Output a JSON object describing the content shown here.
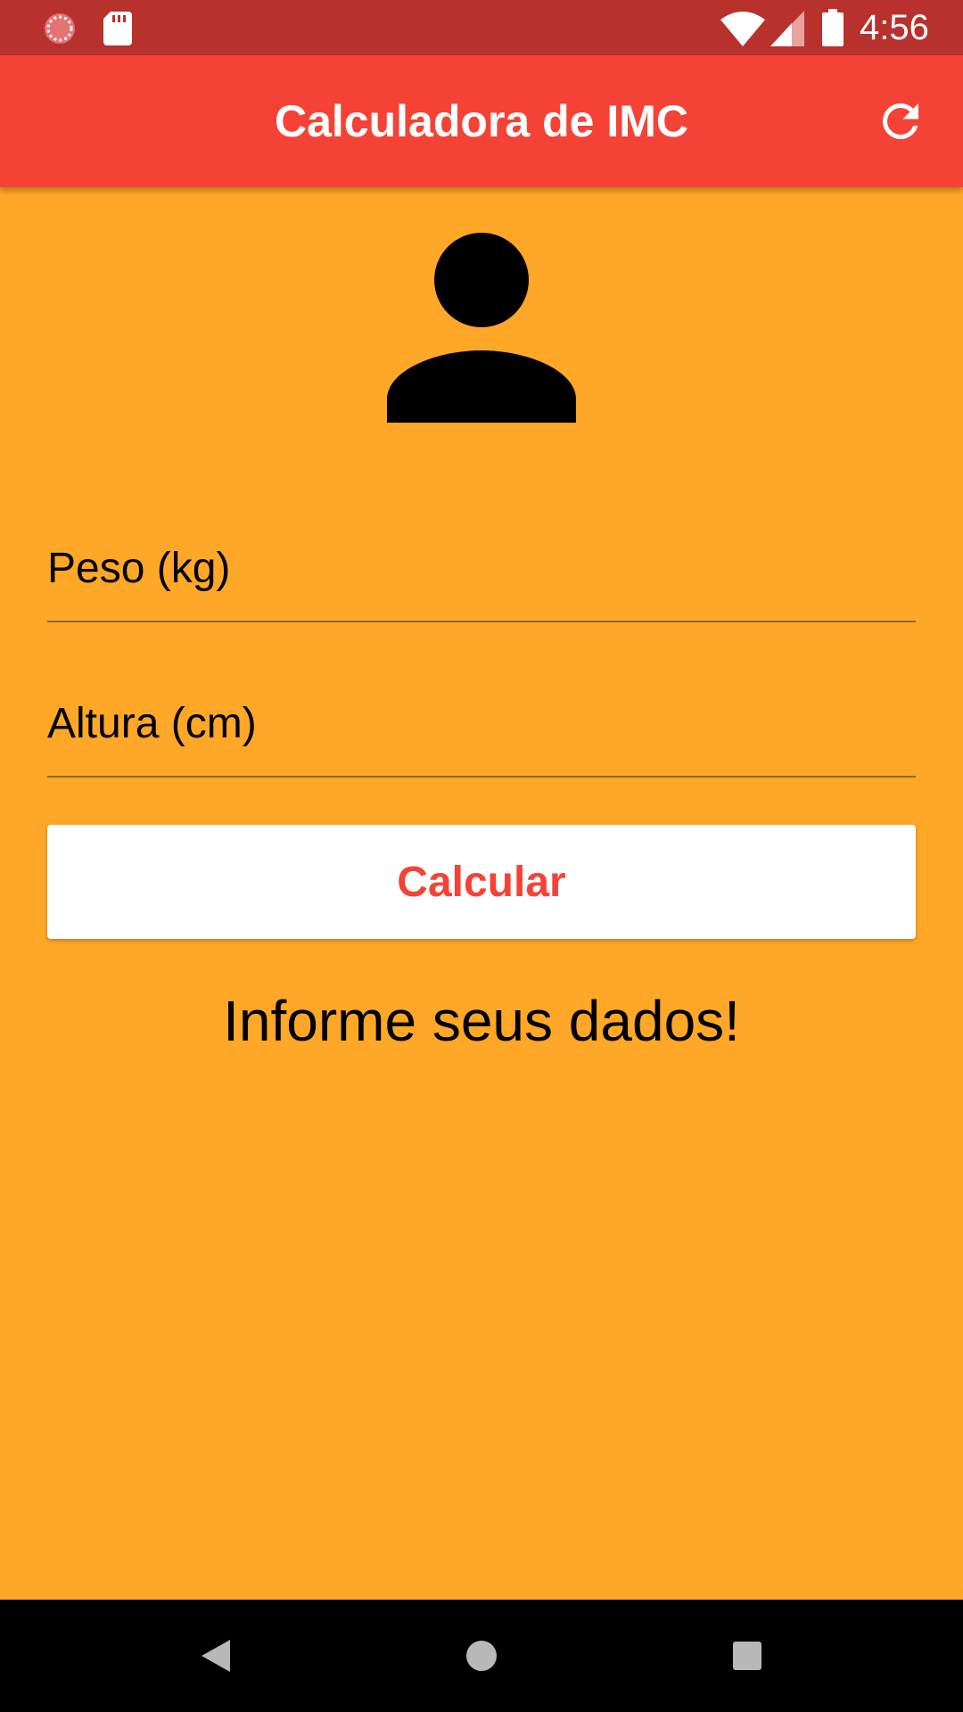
{
  "status_bar": {
    "time": "4:56",
    "left_icons": [
      "loading-spinner-icon",
      "sd-card-icon"
    ],
    "right_icons": [
      "wifi-icon",
      "cell-signal-icon",
      "battery-icon"
    ],
    "color": "#B8312C"
  },
  "app_bar": {
    "title": "Calculadora de IMC",
    "action_icon": "refresh-icon",
    "color": "#F44336"
  },
  "header_icon": "person-icon",
  "form": {
    "weight_placeholder": "Peso (kg)",
    "weight_value": "",
    "height_placeholder": "Altura (cm)",
    "height_value": "",
    "calculate_label": "Calcular"
  },
  "result_message": "Informe seus dados!",
  "nav_bar": {
    "buttons": [
      "back-icon",
      "home-icon",
      "recents-icon"
    ]
  },
  "colors": {
    "background": "#FFA726",
    "accent": "#F44336",
    "status_bar": "#B8312C"
  }
}
